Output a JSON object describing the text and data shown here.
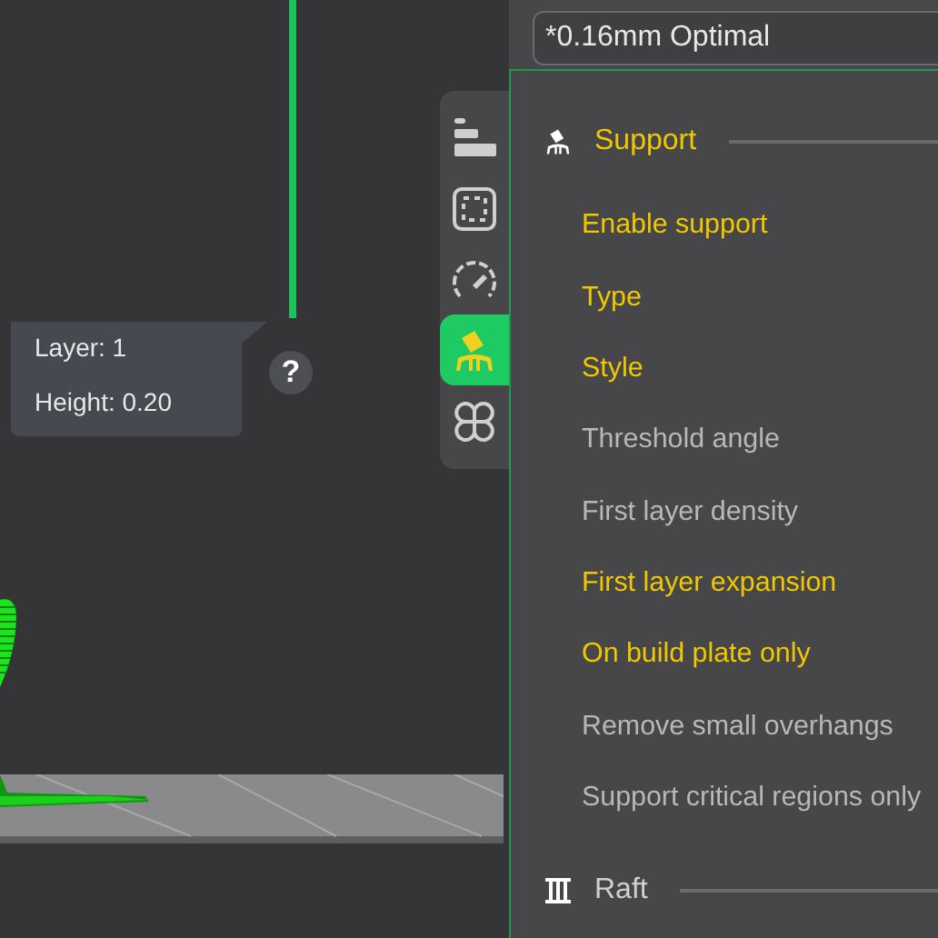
{
  "profile": {
    "value": "*0.16mm Optimal"
  },
  "tabs": [
    {
      "kind": "quality",
      "selected": false
    },
    {
      "kind": "shell",
      "selected": false
    },
    {
      "kind": "speed",
      "selected": false
    },
    {
      "kind": "support",
      "selected": true
    },
    {
      "kind": "other",
      "selected": false
    }
  ],
  "viewport": {
    "layer_info": [
      "Layer: 1",
      "Height: 0.20"
    ],
    "help_button": "?"
  },
  "sections": [
    {
      "title": "Support",
      "kind": "support",
      "settings": [
        {
          "label": "Enable support",
          "modified": true
        },
        {
          "label": "Type",
          "modified": true
        },
        {
          "label": "Style",
          "modified": true
        },
        {
          "label": "Threshold angle",
          "modified": false
        },
        {
          "label": "First layer density",
          "modified": false
        },
        {
          "label": "First layer expansion",
          "modified": true
        },
        {
          "label": "On build plate only",
          "modified": true
        },
        {
          "label": "Remove small overhangs",
          "modified": false
        },
        {
          "label": "Support critical regions only",
          "modified": false
        }
      ]
    },
    {
      "title": "Raft",
      "kind": "raft"
    }
  ]
}
